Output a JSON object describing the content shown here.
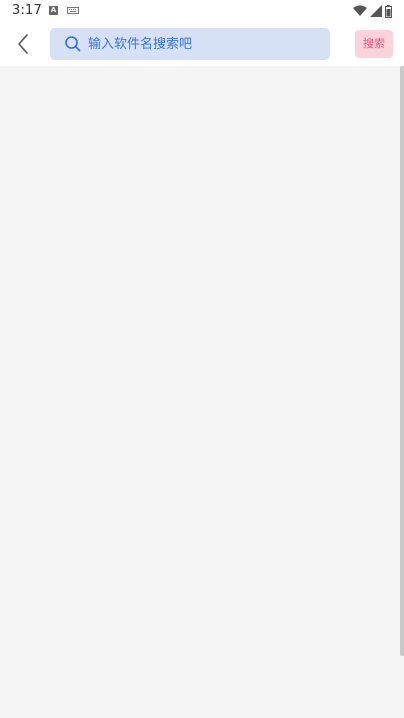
{
  "status_bar": {
    "time": "3:17",
    "icons": [
      "a-notification-icon",
      "keyboard-icon",
      "wifi-icon",
      "cellular-signal-icon",
      "battery-icon"
    ]
  },
  "header": {
    "back_icon": "chevron-left-icon",
    "search": {
      "icon": "search-icon",
      "placeholder": "输入软件名搜索吧",
      "value": ""
    },
    "search_button_label": "搜索"
  },
  "colors": {
    "search_box_bg": "#d6e1f6",
    "search_text": "#3a73d6",
    "search_button_bg": "#fcd3dc",
    "search_button_text": "#e8557a",
    "page_bg": "#f5f5f5"
  }
}
